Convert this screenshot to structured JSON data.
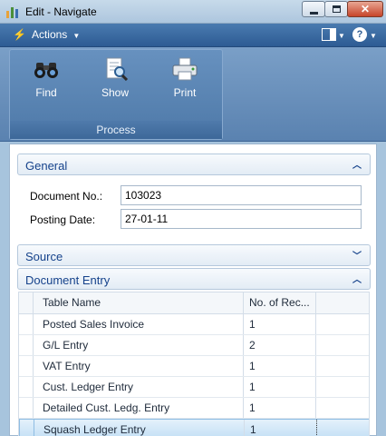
{
  "window": {
    "title": "Edit - Navigate",
    "close_glyph": "✕"
  },
  "commandbar": {
    "actions_label": "Actions",
    "help_label": "?"
  },
  "ribbon": {
    "buttons": [
      {
        "label": "Find",
        "icon": "binoculars-icon"
      },
      {
        "label": "Show",
        "icon": "document-magnifier-icon"
      },
      {
        "label": "Print",
        "icon": "printer-icon"
      }
    ],
    "group_label": "Process"
  },
  "general": {
    "title": "General",
    "fields": [
      {
        "label": "Document No.:",
        "value": "103023"
      },
      {
        "label": "Posting Date:",
        "value": "27-01-11"
      }
    ]
  },
  "source": {
    "title": "Source"
  },
  "document_entry": {
    "title": "Document Entry",
    "columns": [
      "Table Name",
      "No. of Rec..."
    ],
    "rows": [
      {
        "name": "Posted Sales Invoice",
        "count": "1"
      },
      {
        "name": "G/L Entry",
        "count": "2"
      },
      {
        "name": "VAT Entry",
        "count": "1"
      },
      {
        "name": "Cust. Ledger Entry",
        "count": "1"
      },
      {
        "name": "Detailed Cust. Ledg. Entry",
        "count": "1"
      },
      {
        "name": "Squash Ledger Entry",
        "count": "1"
      }
    ],
    "selected_row": 5
  }
}
